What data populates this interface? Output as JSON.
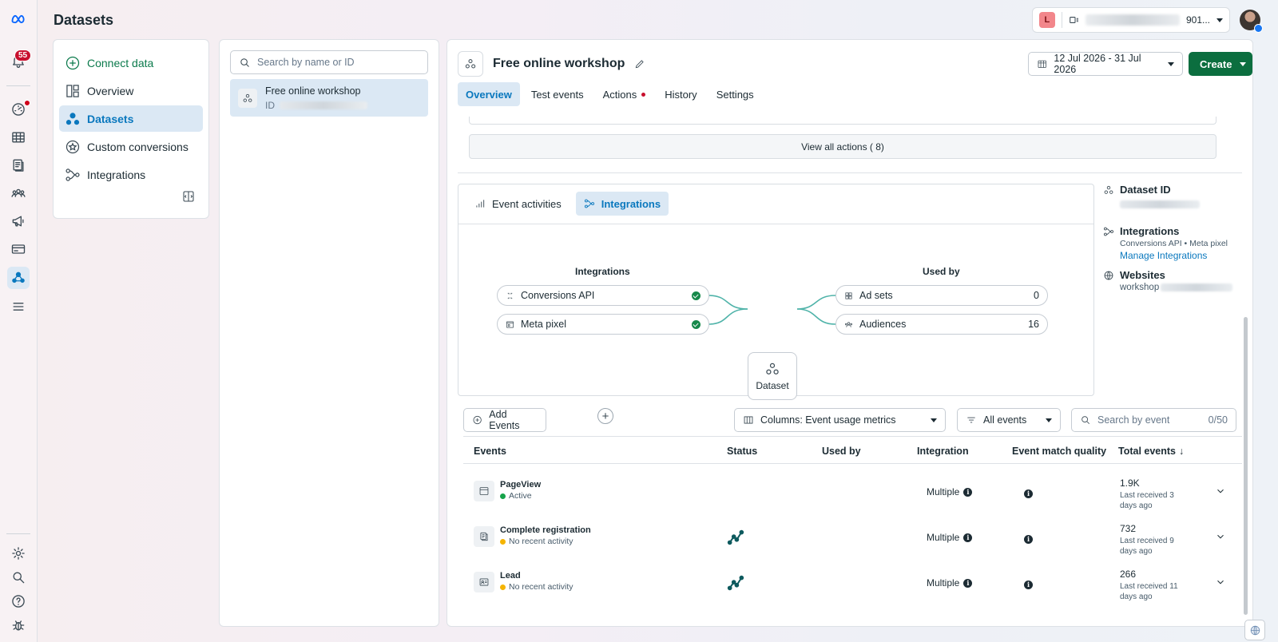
{
  "rail": {
    "notification_count": "55"
  },
  "header": {
    "title": "Datasets",
    "account_initial": "L",
    "account_suffix": "901..."
  },
  "nav": {
    "items": [
      {
        "label": "Connect data"
      },
      {
        "label": "Overview"
      },
      {
        "label": "Datasets"
      },
      {
        "label": "Custom conversions"
      },
      {
        "label": "Integrations"
      }
    ]
  },
  "list": {
    "search_placeholder": "Search by name or ID",
    "dataset_name": "Free online workshop",
    "dataset_id_label": "ID"
  },
  "main": {
    "title": "Free online workshop",
    "date_range": "12 Jul 2026 - 31 Jul 2026",
    "create_label": "Create",
    "tabs": [
      "Overview",
      "Test events",
      "Actions",
      "History",
      "Settings"
    ],
    "view_all": "View all actions ( 8)",
    "panel_tabs": [
      "Event activities",
      "Integrations"
    ],
    "diagram": {
      "integrations_title": "Integrations",
      "used_by_title": "Used by",
      "sources": [
        "Conversions API",
        "Meta pixel"
      ],
      "center": "Dataset",
      "targets": [
        {
          "label": "Ad sets",
          "count": "0"
        },
        {
          "label": "Audiences",
          "count": "16"
        }
      ]
    },
    "side": {
      "dataset_id_title": "Dataset ID",
      "integrations_title": "Integrations",
      "integrations_sub": "Conversions API • Meta pixel",
      "manage_link": "Manage Integrations",
      "websites_title": "Websites",
      "websites_value": "workshop"
    },
    "toolbar": {
      "add_events": "Add Events",
      "columns": "Columns: Event usage metrics",
      "filter": "All events",
      "search_placeholder": "Search by event",
      "search_count": "0/50"
    },
    "table": {
      "headers": [
        "Events",
        "Status",
        "Used by",
        "Integration",
        "Event match quality",
        "Total events"
      ],
      "sort_arrow": "↓",
      "rows": [
        {
          "name": "PageView",
          "status": "Active",
          "status_color": "#16a34a",
          "integration": "Multiple",
          "total": "1.9K",
          "received": "Last received 3 days ago"
        },
        {
          "name": "Complete registration",
          "status": "No recent activity",
          "status_color": "#f5b400",
          "integration": "Multiple",
          "total": "732",
          "received": "Last received 9 days ago"
        },
        {
          "name": "Lead",
          "status": "No recent activity",
          "status_color": "#f5b400",
          "integration": "Multiple",
          "total": "266",
          "received": "Last received 11 days ago"
        }
      ]
    }
  }
}
